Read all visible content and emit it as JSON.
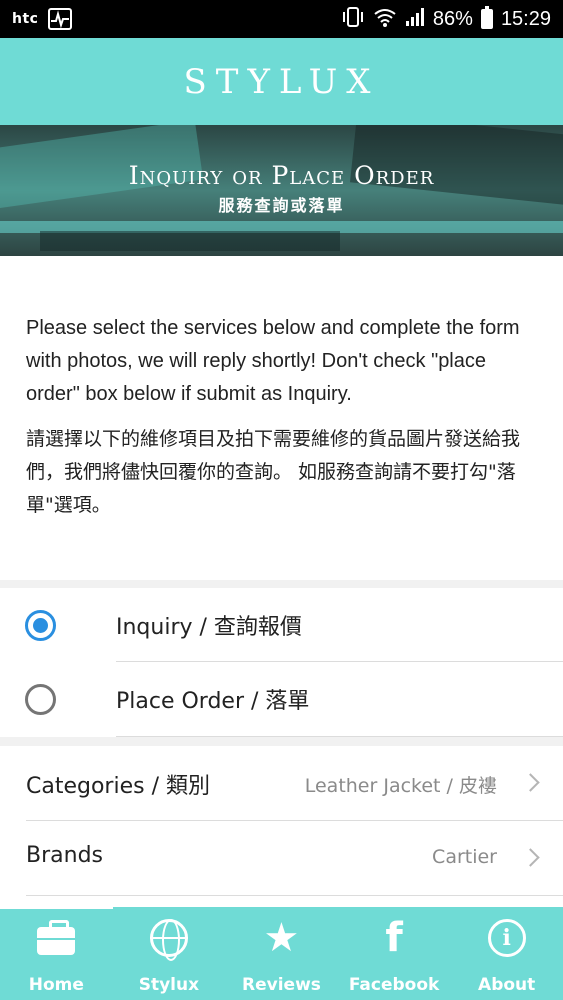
{
  "status_bar": {
    "brand": "htc",
    "battery": "86%",
    "time": "15:29"
  },
  "header": {
    "title": "STYLUX"
  },
  "banner": {
    "title": "Inquiry or Place Order",
    "subtitle": "服務查詢或落單"
  },
  "intro": {
    "en": "Please select the services below and complete the form with photos, we will reply shortly! Don't check \"place order\" box below if submit as Inquiry.",
    "zh": "請選擇以下的維修項目及拍下需要維修的貨品圖片發送給我們，我們將儘快回覆你的查詢。 如服務查詢請不要打勾\"落單\"選項。"
  },
  "order_type": {
    "selected": "Inquiry / 查詢報價",
    "options": [
      {
        "label": "Inquiry / 查詢報價",
        "checked": true
      },
      {
        "label": "Place Order / 落單",
        "checked": false
      }
    ]
  },
  "fields": [
    {
      "label": "Categories / 類別",
      "value": "Leather Jacket / 皮褸"
    },
    {
      "label": "Brands",
      "value": "Cartier"
    }
  ],
  "bottom_nav": {
    "active": "Home",
    "items": [
      {
        "label": "Home",
        "icon": "briefcase-icon"
      },
      {
        "label": "Stylux",
        "icon": "globe-icon"
      },
      {
        "label": "Reviews",
        "icon": "star-icon"
      },
      {
        "label": "Facebook",
        "icon": "facebook-icon"
      },
      {
        "label": "About",
        "icon": "info-icon"
      }
    ]
  }
}
